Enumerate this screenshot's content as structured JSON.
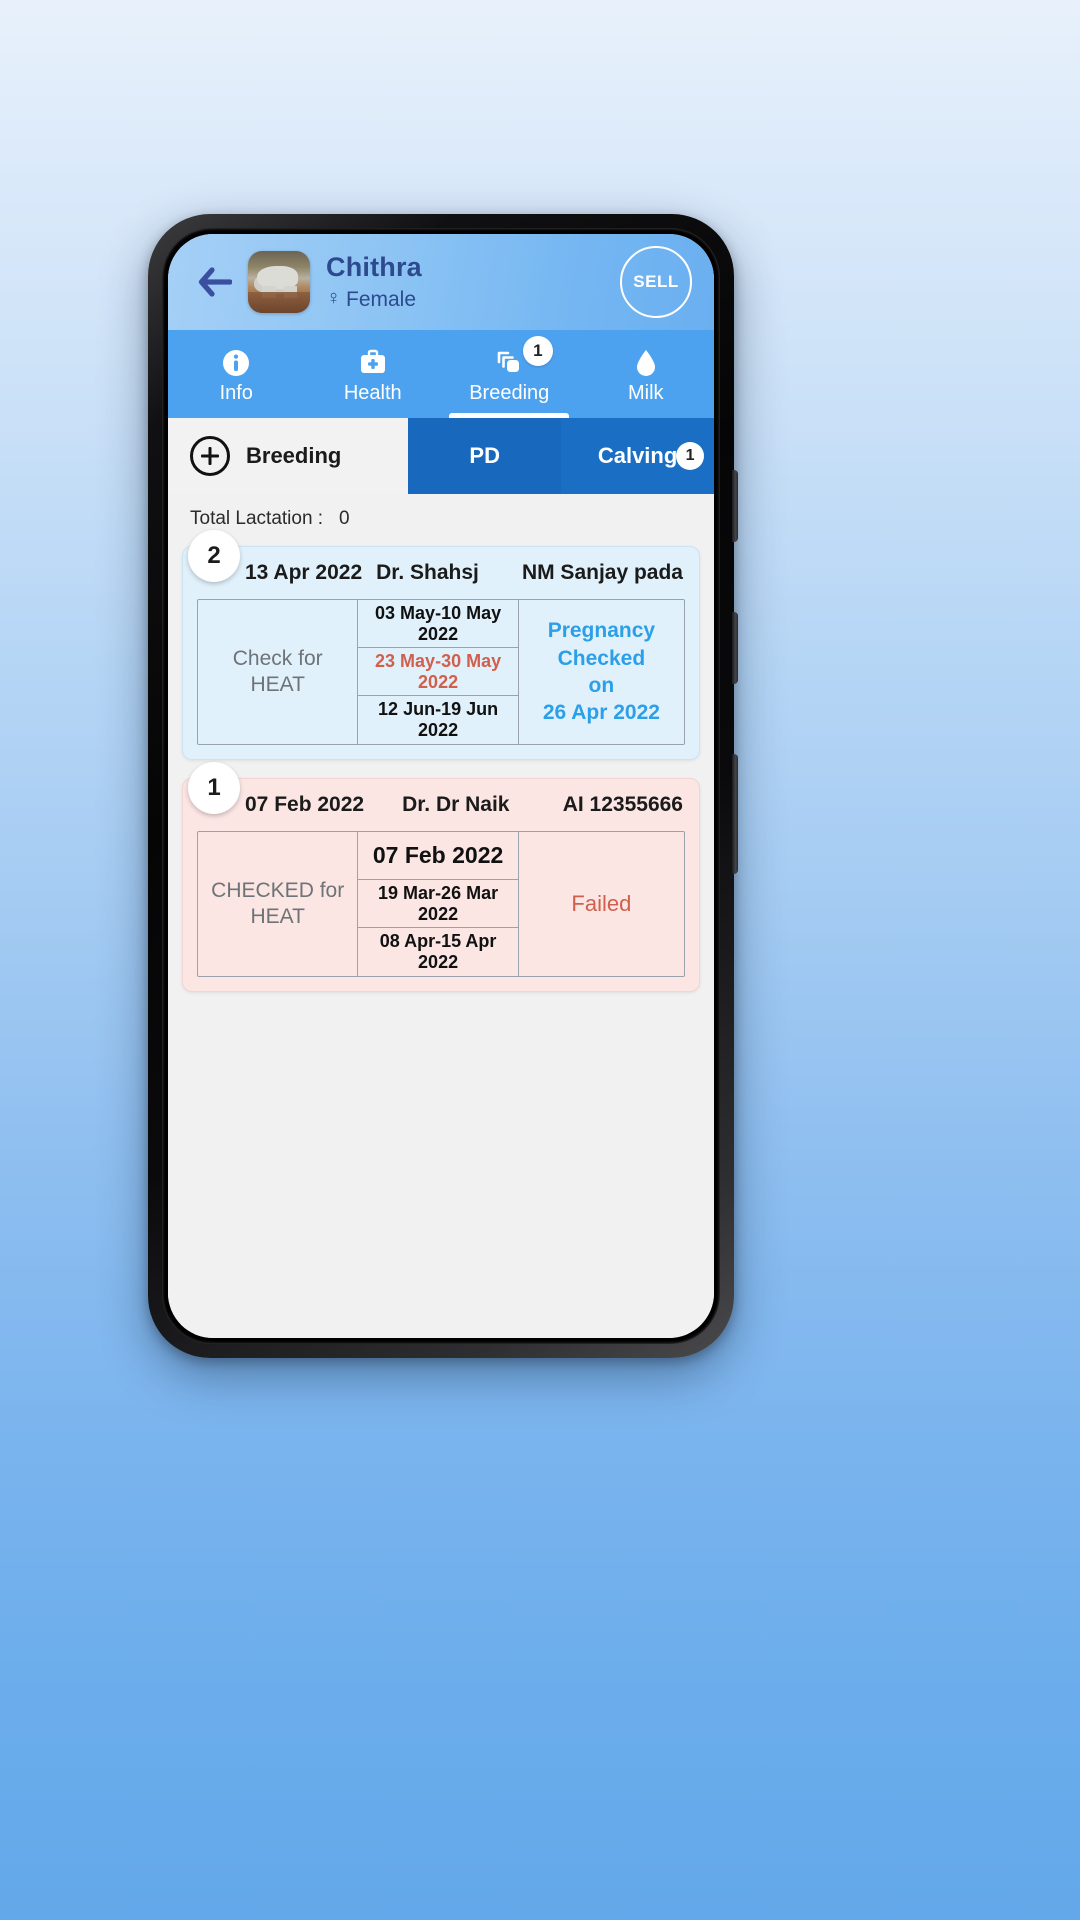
{
  "header": {
    "back_icon": "arrow-left-icon",
    "animal_name": "Chithra",
    "sex_glyph": "♀",
    "sex_label": "Female",
    "sell_label": "SELL",
    "avatar_alt": "cow-photo"
  },
  "tabs": [
    {
      "label": "Info",
      "icon": "info-icon",
      "badge": "",
      "active": false
    },
    {
      "label": "Health",
      "icon": "medkit-icon",
      "badge": "",
      "active": false
    },
    {
      "label": "Breeding",
      "icon": "copies-icon",
      "badge": "1",
      "active": true
    },
    {
      "label": "Milk",
      "icon": "droplet-icon",
      "badge": "",
      "active": false
    }
  ],
  "subtabs": {
    "add_label": "Breeding",
    "add_icon": "plus-circle-icon",
    "segments": [
      {
        "label": "PD",
        "badge": "",
        "selected": true
      },
      {
        "label": "Calving",
        "badge": "1",
        "selected": false
      }
    ]
  },
  "summary": {
    "lactation_label": "Total Lactation :",
    "lactation_value": "0"
  },
  "records": [
    {
      "index": "2",
      "tone": "blue",
      "date": "13 Apr 2022",
      "doctor": "Dr. Shahsj",
      "type": "NM Sanjay pada",
      "left_label_line1": "Check for",
      "left_label_line2": "HEAT",
      "rows": [
        {
          "text": "03 May-10 May 2022",
          "style": "normal"
        },
        {
          "text": "23 May-30 May 2022",
          "style": "warn"
        },
        {
          "text": "12 Jun-19 Jun 2022",
          "style": "normal"
        }
      ],
      "status_line1": "Pregnancy Checked",
      "status_line2": "on",
      "status_line3": "26 Apr 2022",
      "status_kind": "positive"
    },
    {
      "index": "1",
      "tone": "pink",
      "date": "07 Feb 2022",
      "doctor": "Dr. Dr Naik",
      "type": "AI 12355666",
      "left_label_line1": "CHECKED for",
      "left_label_line2": "HEAT",
      "rows": [
        {
          "text": "07 Feb 2022",
          "style": "big"
        },
        {
          "text": "19 Mar-26 Mar 2022",
          "style": "normal"
        },
        {
          "text": "08 Apr-15 Apr 2022",
          "style": "normal"
        }
      ],
      "status_line1": "Failed",
      "status_line2": "",
      "status_line3": "",
      "status_kind": "failed"
    }
  ],
  "colors": {
    "header_blue": "#8dc4f4",
    "tab_blue": "#4da2ef",
    "segment_blue": "#1a6fc4",
    "name_navy": "#2e4a8f",
    "card_blue_bg": "#e1f1fb",
    "card_pink_bg": "#fbe6e4",
    "status_positive": "#2b9fe8",
    "status_failed": "#d0604d"
  }
}
